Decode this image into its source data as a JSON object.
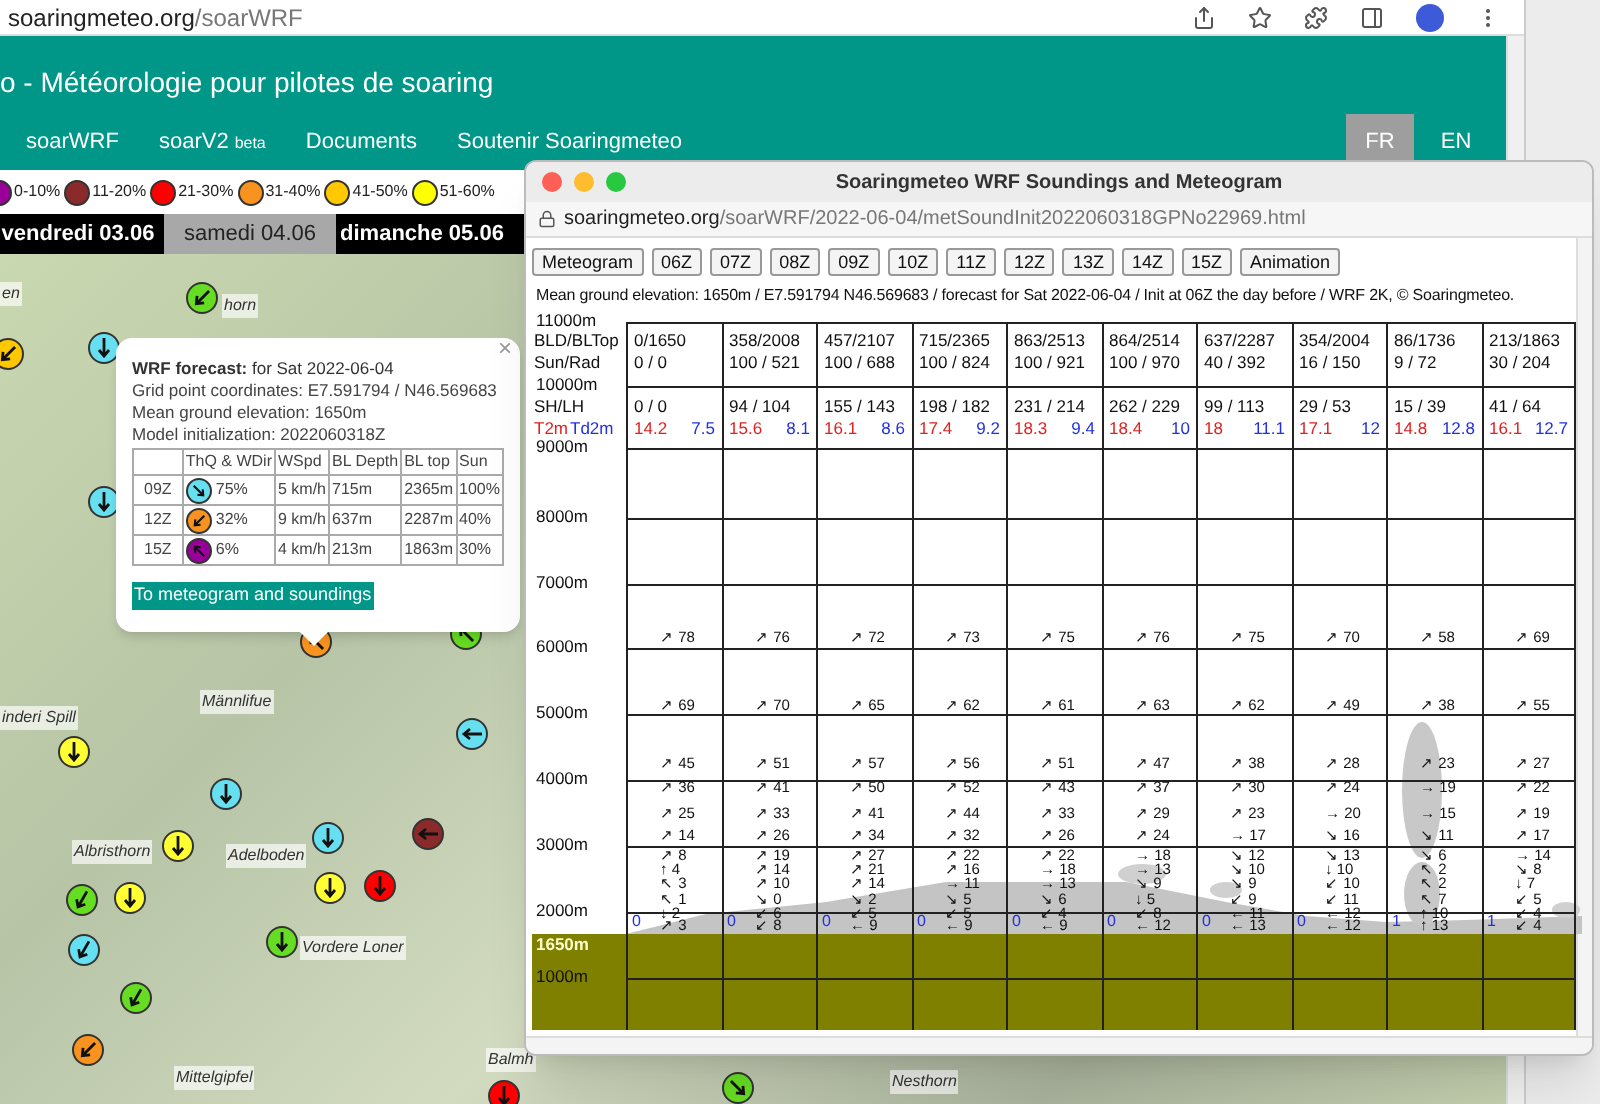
{
  "browser": {
    "url_host": "soaringmeteo.org",
    "url_path": "/soarWRF"
  },
  "header": {
    "title": "o - Météorologie pour pilotes de soaring"
  },
  "nav": [
    {
      "label": "soarWRF"
    },
    {
      "label": "soarV2",
      "badge": "beta"
    },
    {
      "label": "Documents"
    },
    {
      "label": "Soutenir Soaringmeteo"
    }
  ],
  "languages": [
    {
      "label": "FR",
      "selected": true
    },
    {
      "label": "EN",
      "selected": false
    }
  ],
  "legend": [
    {
      "label": "0-10%",
      "color": "#990099"
    },
    {
      "label": "11-20%",
      "color": "#8b2a2a"
    },
    {
      "label": "21-30%",
      "color": "#ff0000"
    },
    {
      "label": "31-40%",
      "color": "#f7931e"
    },
    {
      "label": "41-50%",
      "color": "#ffc800"
    },
    {
      "label": "51-60%",
      "color": "#ffff00"
    }
  ],
  "days": [
    {
      "label": "vendredi 03.06",
      "selected": false
    },
    {
      "label": "samedi 04.06",
      "selected": true
    },
    {
      "label": "dimanche 05.06",
      "selected": false
    }
  ],
  "map": {
    "labels": [
      "en",
      "horn",
      "Männlifue",
      "inderi Spill",
      "Albristhorn",
      "Adelboden",
      "Vordere Loner",
      "Mittelgipfel",
      "Balmh",
      "Nesthorn"
    ],
    "markers": [
      {
        "color": "#66dd22"
      },
      {
        "color": "#ffc800"
      },
      {
        "color": "#66e0f0"
      },
      {
        "color": "#66e0f0"
      },
      {
        "color": "#f7931e"
      },
      {
        "color": "#66dd22"
      },
      {
        "color": "#66e0f0"
      },
      {
        "color": "#ffff33"
      },
      {
        "color": "#66e0f0"
      },
      {
        "color": "#ffff33"
      },
      {
        "color": "#66e0f0"
      },
      {
        "color": "#8b2a2a"
      },
      {
        "color": "#66dd22"
      },
      {
        "color": "#ffff33"
      },
      {
        "color": "#ffff33"
      },
      {
        "color": "#ff0000"
      },
      {
        "color": "#66e0f0"
      },
      {
        "color": "#66dd22"
      },
      {
        "color": "#66dd22"
      },
      {
        "color": "#f7931e"
      },
      {
        "color": "#ff0000"
      },
      {
        "color": "#66dd22"
      }
    ]
  },
  "map_popup": {
    "close": "×",
    "heading": "**WRF forecast:** for Sat 2022-06-04",
    "lines": [
      "Grid point coordinates: E7.591794 / N46.569683",
      "Mean ground elevation: 1650m",
      "Model initialization: 2022060318Z"
    ],
    "columns": [
      "ThQ & WDir",
      "WSpd",
      "BL Depth",
      "BL top",
      "Sun"
    ],
    "rows": [
      {
        "time": "09Z",
        "color": "#66e0f0",
        "thq": "75%",
        "wspd": "5 km/h",
        "bl_depth": "715m",
        "bl_top": "2365m",
        "sun": "100%"
      },
      {
        "time": "12Z",
        "color": "#f7931e",
        "thq": "32%",
        "wspd": "9 km/h",
        "bl_depth": "637m",
        "bl_top": "2287m",
        "sun": "40%"
      },
      {
        "time": "15Z",
        "color": "#990099",
        "thq": "6%",
        "wspd": "4 km/h",
        "bl_depth": "213m",
        "bl_top": "1863m",
        "sun": "30%"
      }
    ],
    "link": "To meteogram and soundings"
  },
  "window": {
    "title": "Soaringmeteo WRF Soundings and Meteogram",
    "url_host": "soaringmeteo.org",
    "url_path": "/soarWRF/2022-06-04/metSoundInit2022060318GPNo22969.html",
    "buttons": [
      "Meteogram",
      "06Z",
      "07Z",
      "08Z",
      "09Z",
      "10Z",
      "11Z",
      "12Z",
      "13Z",
      "14Z",
      "15Z",
      "Animation"
    ],
    "info": "Mean ground elevation: 1650m / E7.591794 N46.569683 / forecast for Sat 2022-06-04 / Init at 06Z the day before / WRF 2K, © Soaringmeteo.",
    "row_labels": {
      "bld": "BLD/BLTop",
      "sun": "Sun/Rad",
      "sh": "SH/LH",
      "t2m": "T2m",
      "td2m": "Td2m"
    },
    "altitudes": [
      {
        "label": "11000m",
        "kind": "line"
      },
      {
        "label": "10000m",
        "kind": "line"
      },
      {
        "label": "9000m",
        "kind": "line"
      },
      {
        "label": "8000m",
        "kind": "line"
      },
      {
        "label": "7000m",
        "kind": "line"
      },
      {
        "label": "6000m",
        "kind": "line"
      },
      {
        "label": "5000m",
        "kind": "line"
      },
      {
        "label": "4000m",
        "kind": "line"
      },
      {
        "label": "3000m",
        "kind": "line"
      },
      {
        "label": "2000m",
        "kind": "line"
      },
      {
        "label": "1650m",
        "kind": "ground"
      },
      {
        "label": "1000m",
        "kind": "line"
      }
    ],
    "columns": [
      {
        "bld": "0/1650",
        "sun": "0 / 0",
        "sh": "0 / 0",
        "t2m": "14.2",
        "td2m": "7.5",
        "base": "0",
        "winds": [
          "↗ 78",
          "↗ 69",
          "↗ 45",
          "↗ 36",
          "↗ 25",
          "↗ 14",
          "↗ 8",
          "↑ 4",
          "↖ 3",
          "↖ 1",
          "↓ 2",
          "↗ 3"
        ]
      },
      {
        "bld": "358/2008",
        "sun": "100 / 521",
        "sh": "94 / 104",
        "t2m": "15.6",
        "td2m": "8.1",
        "base": "0",
        "winds": [
          "↗ 76",
          "↗ 70",
          "↗ 51",
          "↗ 41",
          "↗ 33",
          "↗ 26",
          "↗ 19",
          "↗ 14",
          "↗ 10",
          "↘ 0",
          "↙ 6",
          "↙ 8"
        ]
      },
      {
        "bld": "457/2107",
        "sun": "100 / 688",
        "sh": "155 / 143",
        "t2m": "16.1",
        "td2m": "8.6",
        "base": "0",
        "winds": [
          "↗ 72",
          "↗ 65",
          "↗ 57",
          "↗ 50",
          "↗ 41",
          "↗ 34",
          "↗ 27",
          "↗ 21",
          "↗ 14",
          "↘ 2",
          "↙ 5",
          "← 9"
        ]
      },
      {
        "bld": "715/2365",
        "sun": "100 / 824",
        "sh": "198 / 182",
        "t2m": "17.4",
        "td2m": "9.2",
        "base": "0",
        "winds": [
          "↗ 73",
          "↗ 62",
          "↗ 56",
          "↗ 52",
          "↗ 44",
          "↗ 32",
          "↗ 22",
          "↗ 16",
          "→ 11",
          "↘ 5",
          "↙ 5",
          "← 9"
        ]
      },
      {
        "bld": "863/2513",
        "sun": "100 / 921",
        "sh": "231 / 214",
        "t2m": "18.3",
        "td2m": "9.4",
        "base": "0",
        "winds": [
          "↗ 75",
          "↗ 61",
          "↗ 51",
          "↗ 43",
          "↗ 33",
          "↗ 26",
          "↗ 22",
          "→ 18",
          "→ 13",
          "↘ 6",
          "↙ 4",
          "← 9"
        ]
      },
      {
        "bld": "864/2514",
        "sun": "100 / 970",
        "sh": "262 / 229",
        "t2m": "18.4",
        "td2m": "10",
        "base": "0",
        "winds": [
          "↗ 76",
          "↗ 63",
          "↗ 47",
          "↗ 37",
          "↗ 29",
          "↗ 24",
          "→ 18",
          "→ 13",
          "↘ 9",
          "↓ 5",
          "↙ 8",
          "← 12"
        ]
      },
      {
        "bld": "637/2287",
        "sun": "40 / 392",
        "sh": "99 / 113",
        "t2m": "18",
        "td2m": "11.1",
        "base": "0",
        "winds": [
          "↗ 75",
          "↗ 62",
          "↗ 38",
          "↗ 30",
          "↗ 23",
          "→ 17",
          "↘ 12",
          "↘ 10",
          "↘ 9",
          "↙ 9",
          "← 11",
          "← 13"
        ]
      },
      {
        "bld": "354/2004",
        "sun": "16 / 150",
        "sh": "29 / 53",
        "t2m": "17.1",
        "td2m": "12",
        "base": "0",
        "winds": [
          "↗ 70",
          "↗ 49",
          "↗ 28",
          "↗ 24",
          "→ 20",
          "↘ 16",
          "↘ 13",
          "↓ 10",
          "↙ 10",
          "↙ 11",
          "← 12",
          "← 12"
        ]
      },
      {
        "bld": "86/1736",
        "sun": "9 / 72",
        "sh": "15 / 39",
        "t2m": "14.8",
        "td2m": "12.8",
        "base": "1",
        "winds": [
          "↗ 58",
          "↗ 38",
          "↗ 23",
          "→ 19",
          "→ 15",
          "↘ 11",
          "↘ 6",
          "↖ 2",
          "↖ 2",
          "↖ 7",
          "↑ 10",
          "↑ 13"
        ]
      },
      {
        "bld": "213/1863",
        "sun": "30 / 204",
        "sh": "41 / 64",
        "t2m": "16.1",
        "td2m": "12.7",
        "base": "1",
        "winds": [
          "↗ 69",
          "↗ 55",
          "↗ 27",
          "↗ 22",
          "↗ 19",
          "↗ 17",
          "→ 14",
          "↘ 8",
          "↓ 7",
          "↙ 5",
          "↙ 4",
          "↙ 4"
        ]
      }
    ]
  }
}
